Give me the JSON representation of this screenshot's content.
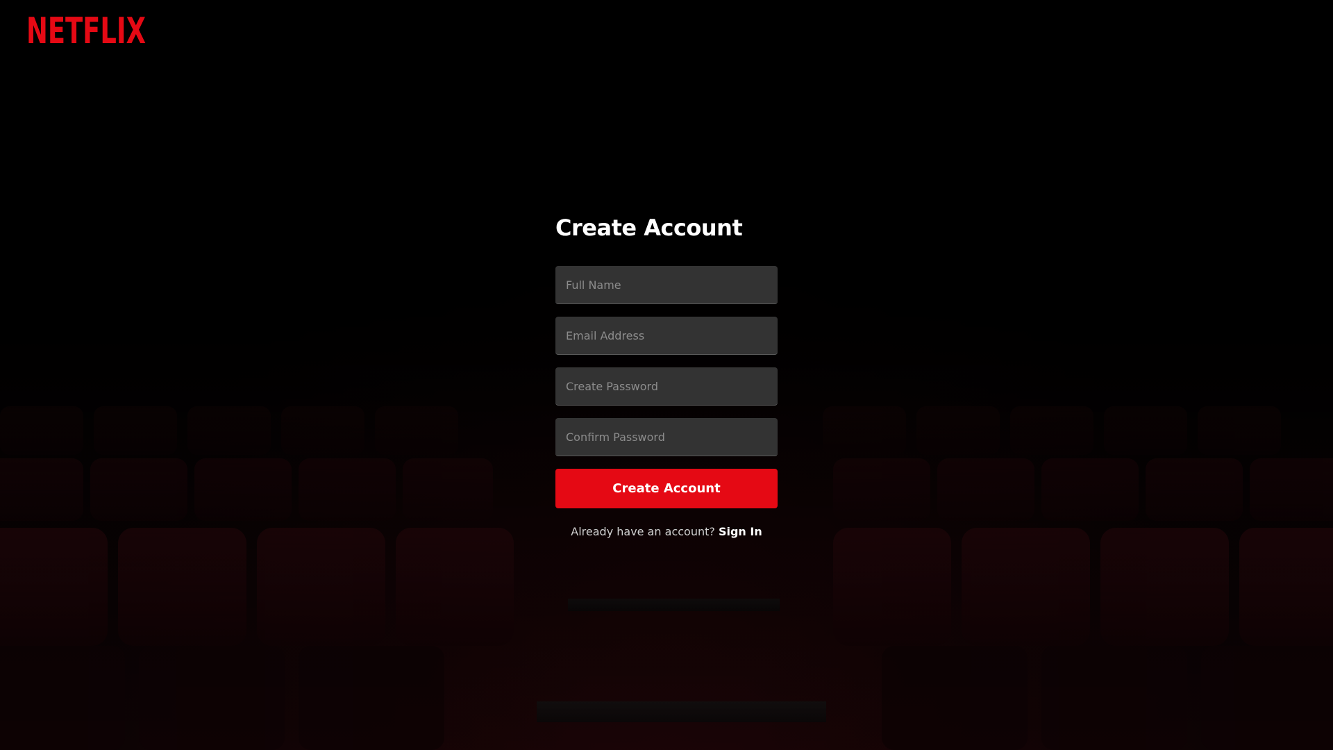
{
  "header": {
    "logo_text": "NETFLIX"
  },
  "form": {
    "title": "Create Account",
    "fields": [
      {
        "placeholder": "Full Name",
        "value": ""
      },
      {
        "placeholder": "Email Address",
        "value": ""
      },
      {
        "placeholder": "Create Password",
        "value": ""
      },
      {
        "placeholder": "Confirm Password",
        "value": ""
      }
    ],
    "submit_label": "Create Account",
    "signin_prompt": "Already have an account?",
    "signin_link": "Sign In"
  },
  "colors": {
    "brand_red": "#e50914",
    "field_bg": "#333333",
    "page_bg": "#000000"
  },
  "icons": {
    "background": "theater-seats-background"
  }
}
